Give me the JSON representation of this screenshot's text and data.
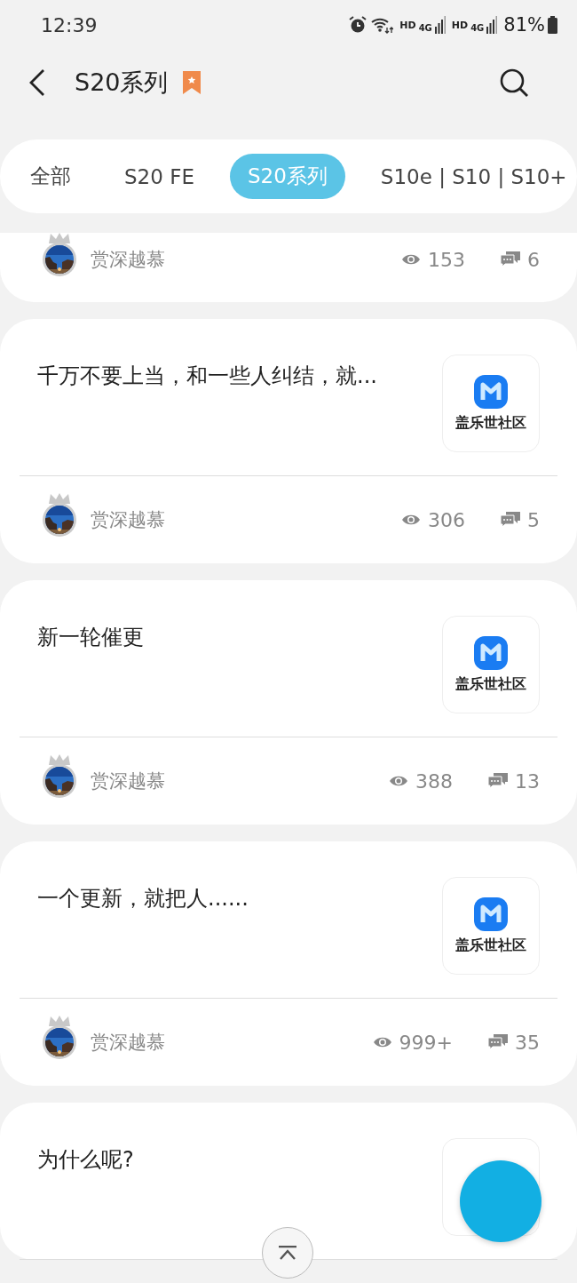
{
  "status_bar": {
    "time": "12:39",
    "networks": [
      {
        "badge": "HD",
        "type": "4G"
      },
      {
        "badge": "HD",
        "type": "4G"
      }
    ],
    "battery": "81%"
  },
  "header": {
    "title": "S20系列",
    "bookmarked": true
  },
  "tabs": [
    {
      "label": "全部",
      "selected": false
    },
    {
      "label": "S20 FE",
      "selected": false
    },
    {
      "label": "S20系列",
      "selected": true
    },
    {
      "label": "S10e | S10 | S10+",
      "selected": false
    }
  ],
  "posts": [
    {
      "author": "赏深越慕",
      "views": "153",
      "comments": "6"
    },
    {
      "title": "千万不要上当，和一些人纠结，就...",
      "thumbnail_label": "盖乐世社区",
      "author": "赏深越慕",
      "views": "306",
      "comments": "5"
    },
    {
      "title": "新一轮催更",
      "thumbnail_label": "盖乐世社区",
      "author": "赏深越慕",
      "views": "388",
      "comments": "13"
    },
    {
      "title": "一个更新，就把人......",
      "thumbnail_label": "盖乐世社区",
      "author": "赏深越慕",
      "views": "999+",
      "comments": "35"
    },
    {
      "title": "为什么呢?"
    }
  ]
}
